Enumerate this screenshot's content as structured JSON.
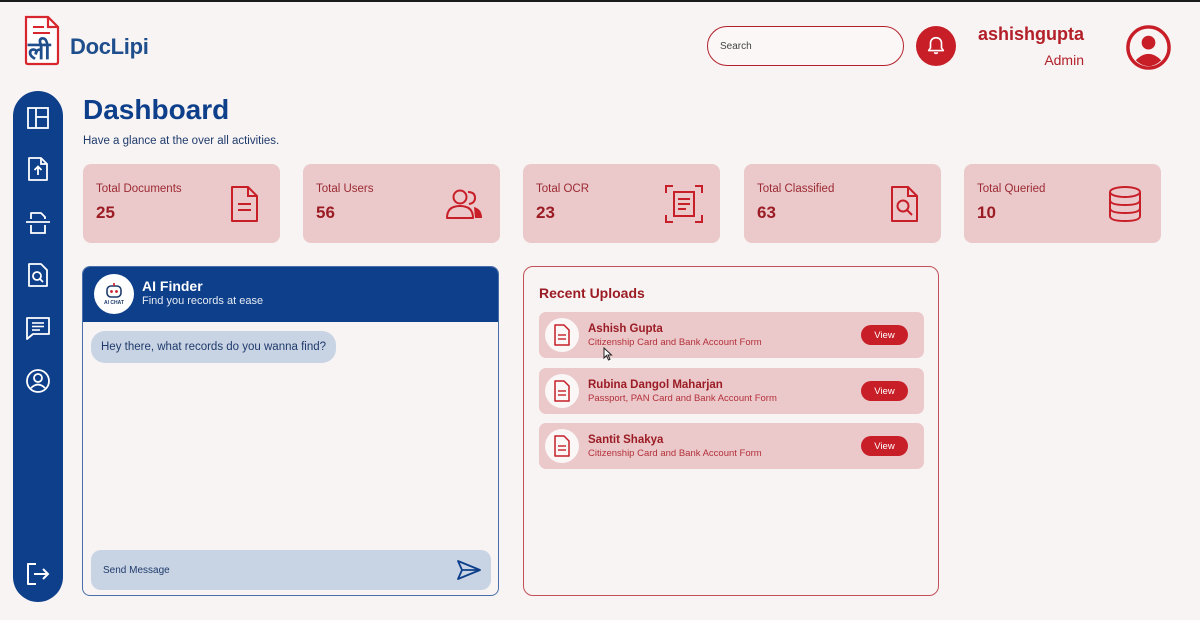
{
  "brand": {
    "logo_glyph": "ली",
    "name": "DocLipi"
  },
  "header": {
    "search_placeholder": "Search",
    "username": "ashishgupta",
    "role": "Admin",
    "bell_icon": "bell-icon",
    "avatar_icon": "user-circle-icon"
  },
  "sidebar": {
    "items": [
      {
        "icon": "dashboard-icon"
      },
      {
        "icon": "upload-file-icon"
      },
      {
        "icon": "scanner-icon"
      },
      {
        "icon": "file-search-icon"
      },
      {
        "icon": "chat-icon"
      },
      {
        "icon": "user-circle-icon"
      }
    ],
    "logout_icon": "logout-icon"
  },
  "page": {
    "title": "Dashboard",
    "subtitle": "Have a glance at the over all activities."
  },
  "stats": [
    {
      "label": "Total Documents",
      "value": "25",
      "icon": "document-icon"
    },
    {
      "label": "Total Users",
      "value": "56",
      "icon": "users-icon"
    },
    {
      "label": "Total OCR",
      "value": "23",
      "icon": "scan-document-icon"
    },
    {
      "label": "Total Classified",
      "value": "63",
      "icon": "file-search-icon"
    },
    {
      "label": "Total Queried",
      "value": "10",
      "icon": "database-icon"
    }
  ],
  "chat": {
    "avatar_label": "AI CHAT",
    "title": "AI Finder",
    "subtitle": "Find you records at ease",
    "greeting": "Hey there, what records do you wanna find?",
    "input_placeholder": "Send Message"
  },
  "uploads": {
    "title": "Recent Uploads",
    "view_label": "View",
    "items": [
      {
        "name": "Ashish Gupta",
        "desc": "Citizenship Card and Bank Account Form"
      },
      {
        "name": "Rubina Dangol Maharjan",
        "desc": "Passport, PAN Card and Bank Account Form"
      },
      {
        "name": "Santit Shakya",
        "desc": "Citizenship Card and Bank Account Form"
      }
    ]
  },
  "colors": {
    "primary_blue": "#0d3f8a",
    "accent_red": "#c81e28",
    "card_pink": "#ebc9cb",
    "background": "#f8f4f4"
  }
}
